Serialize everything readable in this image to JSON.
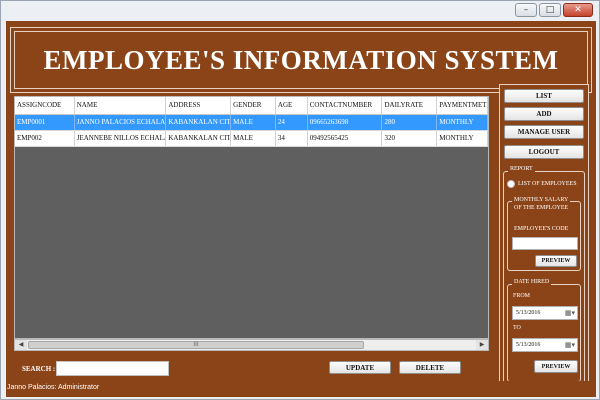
{
  "window": {
    "minimize_icon": "minimize-icon",
    "maximize_icon": "maximize-icon",
    "close_icon": "close-icon"
  },
  "header": {
    "title": "EMPLOYEE'S INFORMATION SYSTEM"
  },
  "table": {
    "columns": [
      "ASSIGNCODE",
      "NAME",
      "ADDRESS",
      "GENDER",
      "AGE",
      "CONTACTNUMBER",
      "DAILYRATE",
      "PAYMENTMETH"
    ],
    "rows": [
      [
        "EMP0001",
        "JANNO PALACIOS ECHALAR",
        "KABANKALAN CITY",
        "MALE",
        "24",
        "09665263698",
        "280",
        "MONTHLY"
      ],
      [
        "EMP002",
        "JEANNEBE NILLOS ECHALAR",
        "KABANKALAN CITY",
        "MALE",
        "34",
        "09492565425",
        "320",
        "MONTHLY"
      ]
    ],
    "selected_row": 0
  },
  "scrollbar": {
    "thumb_grip": "III"
  },
  "search": {
    "label": "SEARCH :",
    "value": ""
  },
  "actions": {
    "update": "UPDATE",
    "delete": "DELETE"
  },
  "sidebar": {
    "list": "LIST",
    "add": "ADD",
    "manage_user": "MANAGE USER",
    "logout": "LOGOUT"
  },
  "report": {
    "legend": "REPORT",
    "list_option": "LIST OF EMPLOYEES",
    "monthly": {
      "legend_line1": "MONTHLY SALARY",
      "legend_line2": "OF THE EMPLOYEE",
      "code_label": "EMPLOYEE'S CODE",
      "code_value": "",
      "preview": "PREVIEW"
    },
    "date_hired": {
      "legend": "DATE HIRED",
      "from_label": "FROM",
      "from_value": "5/13/2016",
      "to_label": "TO",
      "to_value": "5/13/2016",
      "preview": "PREVIEW"
    }
  },
  "status": {
    "text": "Janno Palacios: Administrator"
  },
  "colors": {
    "brand": "#8b4418",
    "selection": "#3399ff",
    "grid_bg": "#5f5f5f"
  }
}
